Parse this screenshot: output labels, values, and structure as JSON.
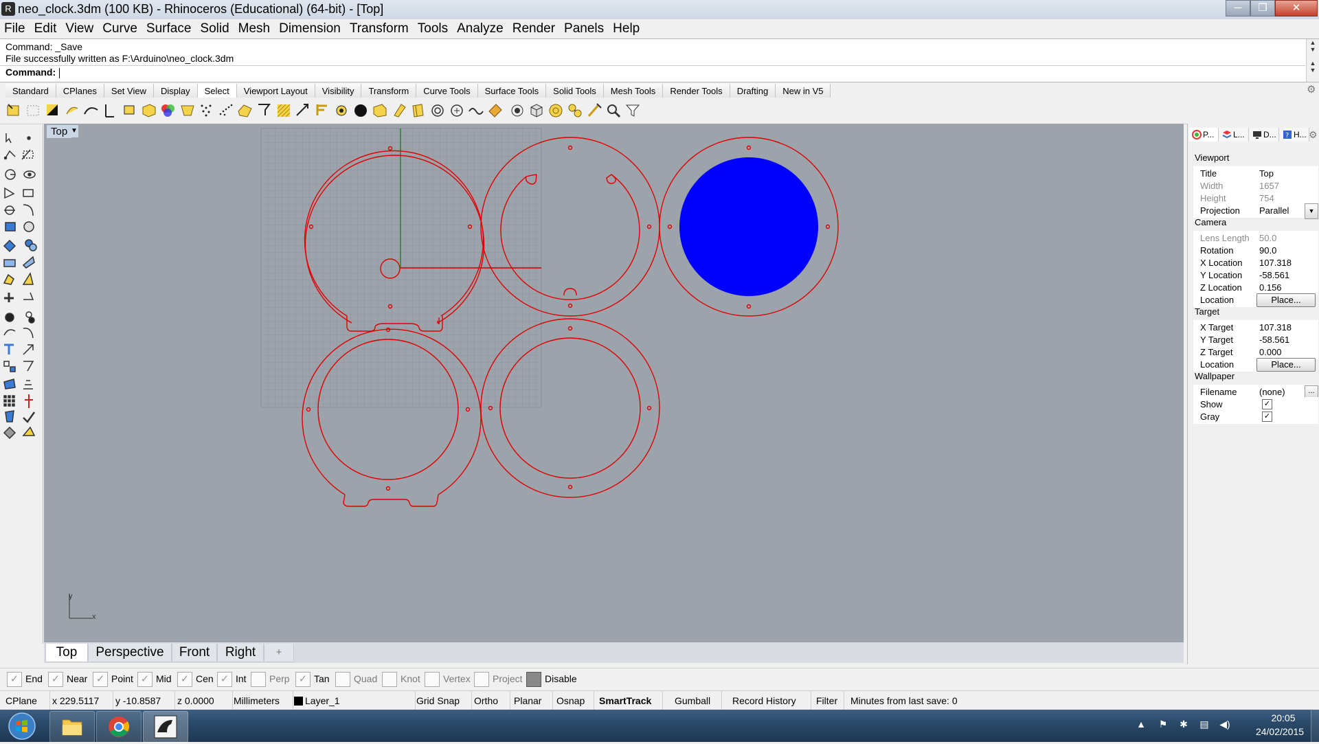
{
  "window": {
    "title": "neo_clock.3dm (100 KB) - Rhinoceros (Educational) (64-bit) - [Top]",
    "minimize": "─",
    "maximize": "❐",
    "close": "✕"
  },
  "menu": [
    "File",
    "Edit",
    "View",
    "Curve",
    "Surface",
    "Solid",
    "Mesh",
    "Dimension",
    "Transform",
    "Tools",
    "Analyze",
    "Render",
    "Panels",
    "Help"
  ],
  "command_history": [
    "Command: _Save",
    "File successfully written as F:\\Arduino\\neo_clock.3dm"
  ],
  "command_prompt": "Command:",
  "toolbar_tabs": [
    "Standard",
    "CPlanes",
    "Set View",
    "Display",
    "Select",
    "Viewport Layout",
    "Visibility",
    "Transform",
    "Curve Tools",
    "Surface Tools",
    "Solid Tools",
    "Mesh Tools",
    "Render Tools",
    "Drafting",
    "New in V5"
  ],
  "active_toolbar_tab": "Select",
  "viewport": {
    "label": "Top",
    "axis_y": "y",
    "axis_x": "x",
    "curve_color": "#e00000",
    "fill_color": "#0000ff",
    "background": "#9da3ab"
  },
  "viewport_tabs": [
    "Top",
    "Perspective",
    "Front",
    "Right"
  ],
  "viewport_tab_add": "+",
  "properties": {
    "tabs": [
      "P...",
      "L...",
      "D...",
      "H..."
    ],
    "viewport_section": "Viewport",
    "title_label": "Title",
    "title_value": "Top",
    "width_label": "Width",
    "width_value": "1657",
    "height_label": "Height",
    "height_value": "754",
    "projection_label": "Projection",
    "projection_value": "Parallel",
    "camera_section": "Camera",
    "lens_label": "Lens Length",
    "lens_value": "50.0",
    "rotation_label": "Rotation",
    "rotation_value": "90.0",
    "xloc_label": "X Location",
    "xloc_value": "107.318",
    "yloc_label": "Y Location",
    "yloc_value": "-58.561",
    "zloc_label": "Z Location",
    "zloc_value": "0.156",
    "location_label": "Location",
    "place_button": "Place...",
    "target_section": "Target",
    "xtarget_label": "X Target",
    "xtarget_value": "107.318",
    "ytarget_label": "Y Target",
    "ytarget_value": "-58.561",
    "ztarget_label": "Z Target",
    "ztarget_value": "0.000",
    "target_location_label": "Location",
    "target_place_button": "Place...",
    "wallpaper_section": "Wallpaper",
    "filename_label": "Filename",
    "filename_value": "(none)",
    "filename_button": "...",
    "show_label": "Show",
    "show_checked": true,
    "gray_label": "Gray",
    "gray_checked": true
  },
  "osnaps": [
    {
      "label": "End",
      "checked": true
    },
    {
      "label": "Near",
      "checked": true
    },
    {
      "label": "Point",
      "checked": true
    },
    {
      "label": "Mid",
      "checked": true
    },
    {
      "label": "Cen",
      "checked": true
    },
    {
      "label": "Int",
      "checked": true
    },
    {
      "label": "Perp",
      "checked": false
    },
    {
      "label": "Tan",
      "checked": true
    },
    {
      "label": "Quad",
      "checked": false
    },
    {
      "label": "Knot",
      "checked": false
    },
    {
      "label": "Vertex",
      "checked": false
    },
    {
      "label": "Project",
      "checked": false
    },
    {
      "label": "Disable",
      "checked": false
    }
  ],
  "status": {
    "cplane": "CPlane",
    "x": "x 229.5117",
    "y": "y -10.8587",
    "z": "z 0.0000",
    "units": "Millimeters",
    "layer": "Layer_1",
    "grid_snap": "Grid Snap",
    "ortho": "Ortho",
    "planar": "Planar",
    "osnap": "Osnap",
    "smarttrack": "SmartTrack",
    "gumball": "Gumball",
    "record_history": "Record History",
    "filter": "Filter",
    "minutes": "Minutes from last save: 0"
  },
  "taskbar": {
    "time": "20:05",
    "date": "24/02/2015"
  }
}
